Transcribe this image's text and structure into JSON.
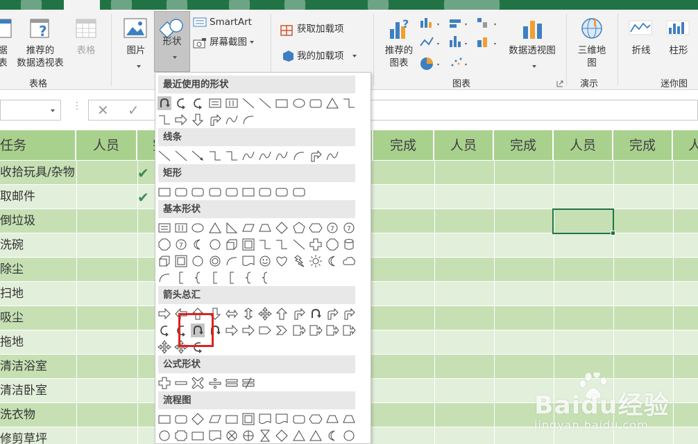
{
  "ribbon": {
    "buttons": {
      "pivot_left": "据\n表",
      "recommended_pivot": "推荐的\n数据透视表",
      "table": "表格",
      "picture": "图片",
      "shapes": "形状",
      "smartart": "SmartArt",
      "screenshot": "屏幕截图",
      "get_addins": "获取加载项",
      "my_addins": "我的加载项",
      "recommended_charts": "推荐的\n图表",
      "pivot_chart": "数据透视图",
      "map_3d": "三维地\n图",
      "line_spark": "折线",
      "column_spark": "柱形"
    },
    "groups": {
      "tables": "表格",
      "charts": "图表",
      "tours": "演示",
      "sparklines": "迷你图"
    }
  },
  "formula_bar": {
    "cancel_glyph": "✕",
    "enter_glyph": "✓"
  },
  "sheet": {
    "headers": [
      "任务",
      "人员",
      "完",
      "完成",
      "人员",
      "完成",
      "人员",
      "完成",
      "人"
    ],
    "tasks": [
      "收拾玩具/杂物",
      "取邮件",
      "倒垃圾",
      "洗碗",
      "除尘",
      "扫地",
      "吸尘",
      "拖地",
      "清洁浴室",
      "清洁卧室",
      "洗衣物",
      "修剪草坪"
    ],
    "checks": [
      "✔",
      "✔"
    ]
  },
  "shapes_menu": {
    "sections": {
      "recent": "最近使用的形状",
      "lines": "线条",
      "rectangles": "矩形",
      "basic": "基本形状",
      "arrows": "箭头总汇",
      "equation": "公式形状",
      "flowchart": "流程图"
    }
  },
  "watermark": {
    "brand": "Baidu经验",
    "url": "jingyan.baidu.com"
  },
  "colors": {
    "excel_green": "#217346",
    "header_green": "#a9d18e",
    "row_dark": "#c6e0b4",
    "row_light": "#e2efda",
    "highlight_red": "#e02020"
  }
}
